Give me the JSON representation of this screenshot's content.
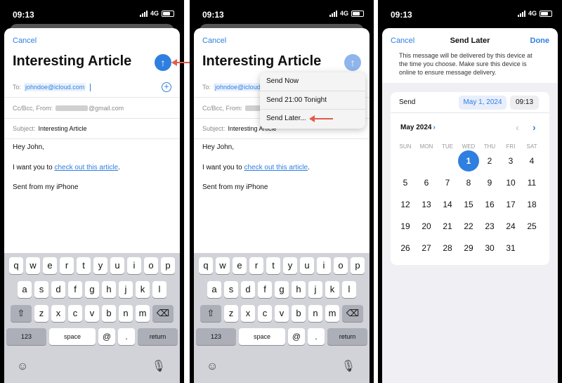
{
  "status": {
    "time": "09:13",
    "network": "4G"
  },
  "compose": {
    "cancel": "Cancel",
    "title": "Interesting Article",
    "send_icon": "↑",
    "to_label": "To:",
    "to_value": "johndoe@icloud.com",
    "cc_label": "Cc/Bcc, From:",
    "cc_domain": "@gmail.com",
    "subject_label": "Subject:",
    "subject_value": "Interesting Article",
    "greeting": "Hey John,",
    "body_pre": "I want you to ",
    "body_link": "check out this article",
    "body_post": ".",
    "signature": "Sent from my iPhone",
    "plus_icon": "+"
  },
  "keyboard": {
    "row1": [
      "q",
      "w",
      "e",
      "r",
      "t",
      "y",
      "u",
      "i",
      "o",
      "p"
    ],
    "row2": [
      "a",
      "s",
      "d",
      "f",
      "g",
      "h",
      "j",
      "k",
      "l"
    ],
    "row3": [
      "z",
      "x",
      "c",
      "v",
      "b",
      "n",
      "m"
    ],
    "shift": "⇧",
    "delete": "⌫",
    "numbers": "123",
    "space": "space",
    "at": "@",
    "period": ".",
    "return": "return",
    "emoji": "☺",
    "mic": "🎙"
  },
  "send_menu": {
    "items": [
      "Send Now",
      "Send 21:00 Tonight",
      "Send Later..."
    ]
  },
  "send_later": {
    "cancel": "Cancel",
    "title": "Send Later",
    "done": "Done",
    "notice": "This message will be delivered by this device at the time you choose. Make sure this device is online to ensure message delivery.",
    "send_label": "Send",
    "date_value": "May 1, 2024",
    "time_value": "09:13",
    "month": "May 2024",
    "month_chevron": "›",
    "prev": "‹",
    "next": "›",
    "weekdays": [
      "SUN",
      "MON",
      "TUE",
      "WED",
      "THU",
      "FRI",
      "SAT"
    ],
    "selected_day": 1,
    "first_weekday": 3,
    "days_in_month": 31
  }
}
